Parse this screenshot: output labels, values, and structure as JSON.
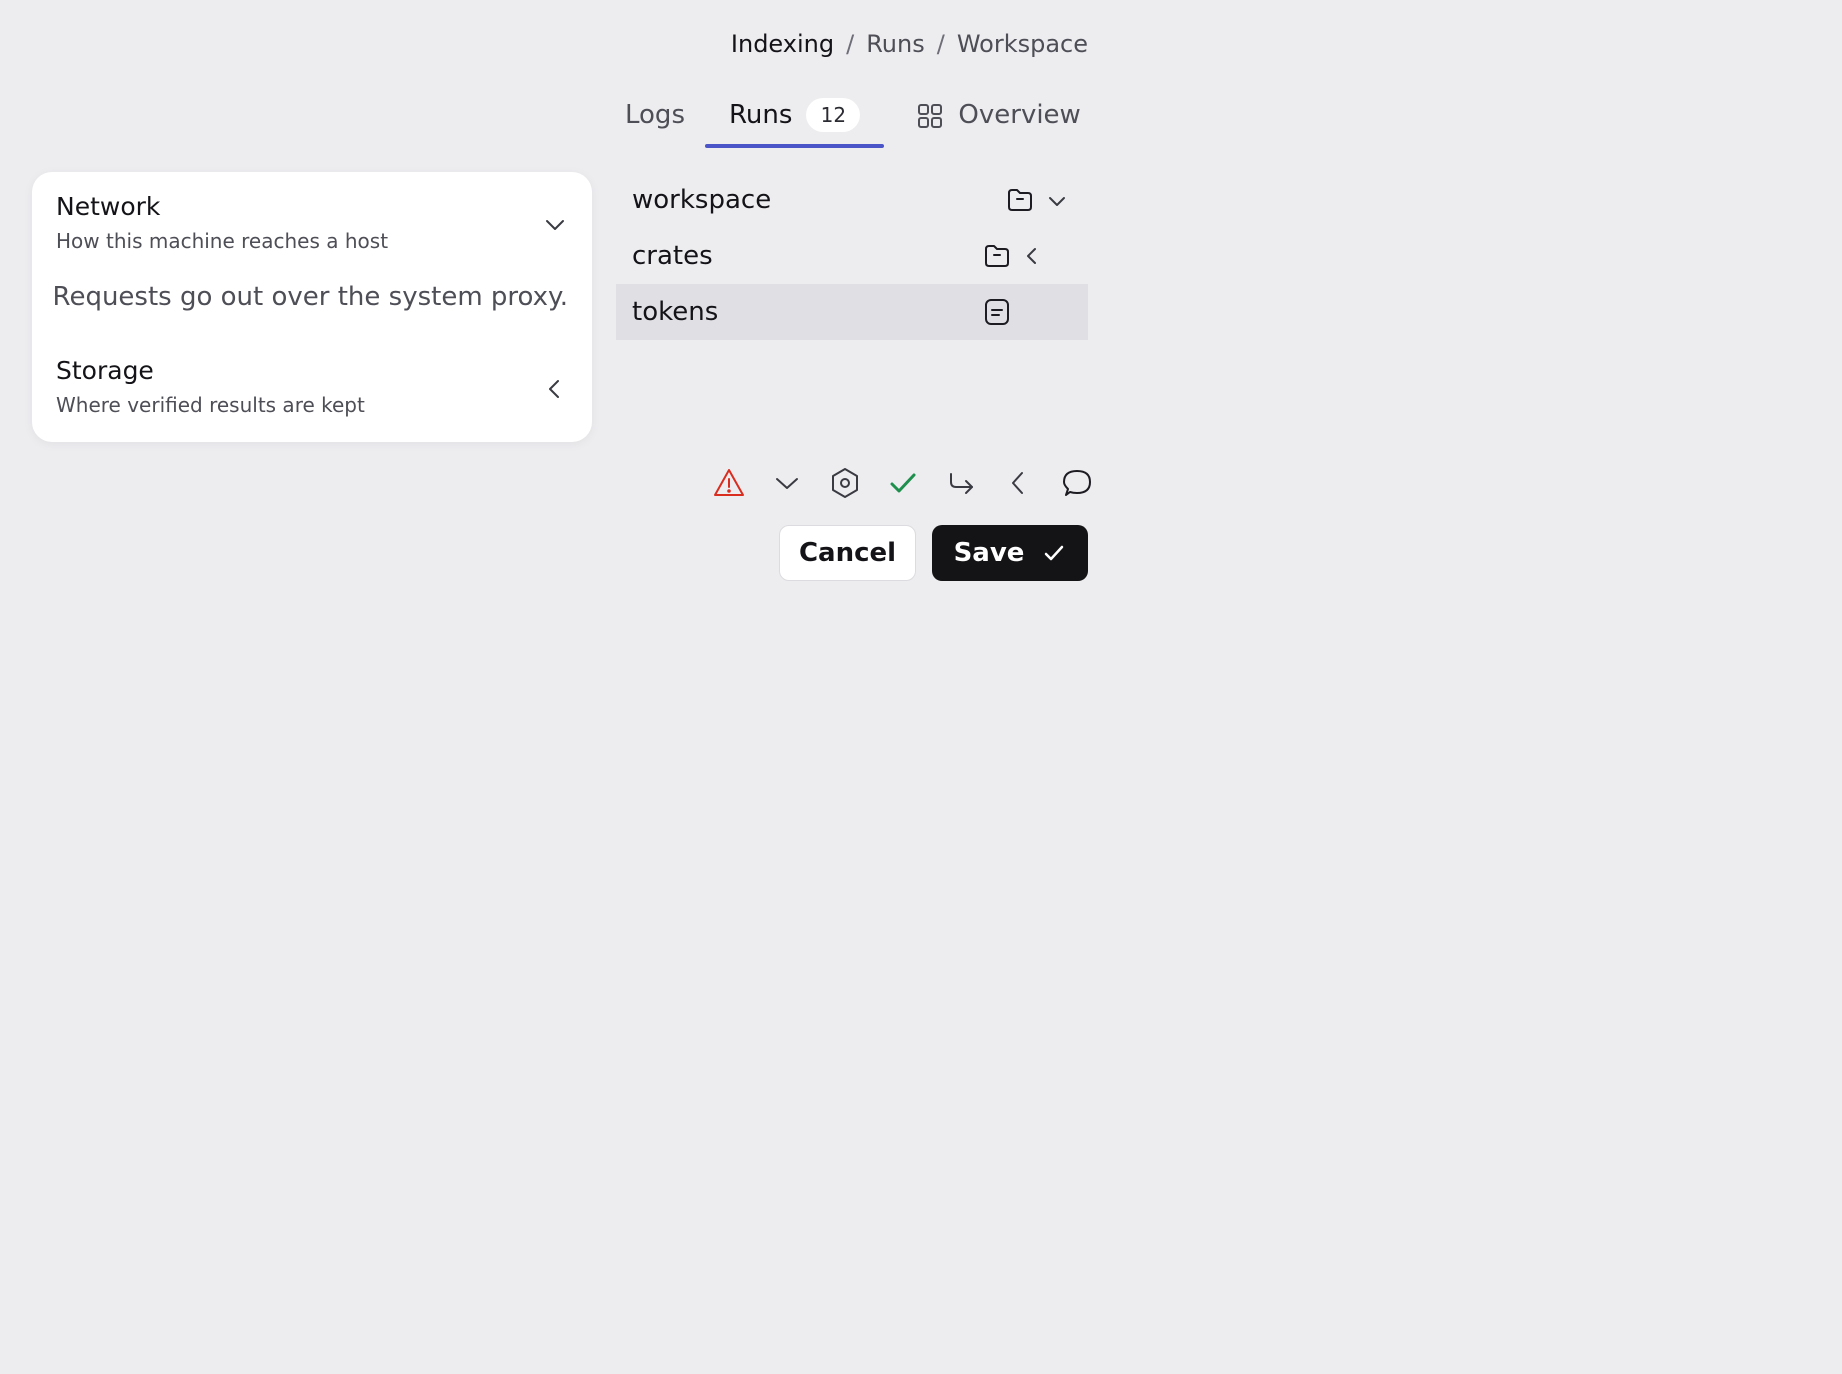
{
  "breadcrumb": {
    "items": [
      "Indexing",
      "Runs",
      "Workspace"
    ],
    "separator": "/"
  },
  "tabs": [
    {
      "label": "Logs",
      "active": false
    },
    {
      "label": "Runs",
      "active": true,
      "badge": "12"
    },
    {
      "label": "Overview",
      "active": false,
      "icon": "grid-icon"
    }
  ],
  "settings": {
    "network": {
      "title": "Network",
      "subtitle": "How this machine reaches a host",
      "expanded": true,
      "detail": "Requests go out over the system proxy.",
      "icon": "chevron-down-icon"
    },
    "storage": {
      "title": "Storage",
      "subtitle": "Where verified results are kept",
      "expanded": false,
      "icon": "chevron-left-icon"
    }
  },
  "tree": [
    {
      "label": "workspace",
      "icon": "folder-icon",
      "toggle": "chevron-down-icon",
      "selected": false
    },
    {
      "label": "crates",
      "icon": "folder-icon",
      "toggle": "chevron-left-icon",
      "selected": false
    },
    {
      "label": "tokens",
      "icon": "file-icon",
      "selected": true
    }
  ],
  "toolbar": {
    "icons": [
      "warning-icon",
      "chevron-down-icon",
      "settings-hex-icon",
      "check-icon",
      "forward-arrow-icon",
      "chevron-left-icon",
      "comment-icon"
    ]
  },
  "actions": {
    "cancel_label": "Cancel",
    "save_label": "Save"
  },
  "colors": {
    "background": "#ededf0",
    "accent": "#4b55c8",
    "warning": "#d92d20",
    "success": "#1f8f4e",
    "primary_button": "#141416"
  }
}
